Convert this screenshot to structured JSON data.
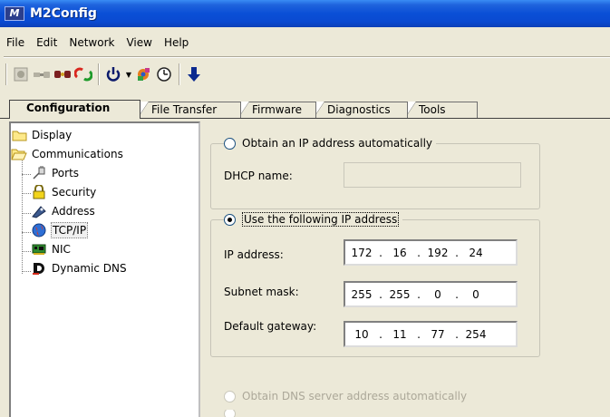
{
  "window": {
    "title": "M2Config",
    "app_icon_text": "M"
  },
  "menu": [
    "File",
    "Edit",
    "Network",
    "View",
    "Help"
  ],
  "toolbar": {
    "icons": [
      "record-icon",
      "connect-icon",
      "disconnect-icon",
      "refresh-icon",
      "power-icon",
      "settings-icon",
      "clock-icon",
      "download-icon"
    ]
  },
  "tabs": [
    "Configuration",
    "File Transfer",
    "Firmware",
    "Diagnostics",
    "Tools"
  ],
  "active_tab": "Configuration",
  "tree": {
    "display": "Display",
    "communications": "Communications",
    "children": [
      "Ports",
      "Security",
      "Address",
      "TCP/IP",
      "NIC",
      "Dynamic DNS"
    ],
    "selected": "TCP/IP"
  },
  "ip_auto": {
    "label": "Obtain an IP address automatically",
    "dhcp_label": "DHCP name:",
    "dhcp_value": ""
  },
  "ip_manual": {
    "label": "Use the following IP address",
    "ip_label": "IP address:",
    "ip": [
      "172",
      "16",
      "192",
      "24"
    ],
    "subnet_label": "Subnet mask:",
    "subnet": [
      "255",
      "255",
      "0",
      "0"
    ],
    "gateway_label": "Default gateway:",
    "gateway": [
      "10",
      "11",
      "77",
      "254"
    ]
  },
  "dns": {
    "auto_label": "Obtain DNS server address automatically"
  },
  "colors": {
    "title_bar": "#0a4fd6",
    "panel_bg": "#ece9d8",
    "radio_dot": "#21a121"
  }
}
